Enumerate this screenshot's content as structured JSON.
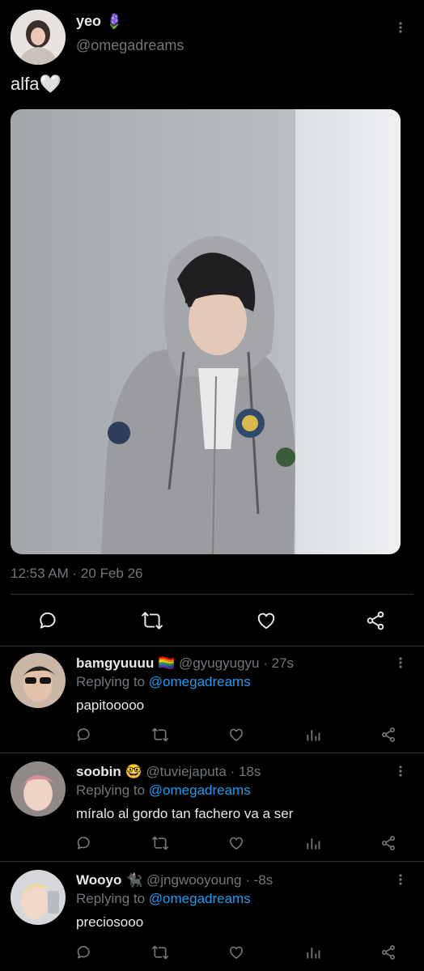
{
  "tweet": {
    "author_name": "yeo",
    "author_emoji": "🪻",
    "author_handle": "@omegadreams",
    "text": "alfa🤍",
    "timestamp": "12:53 AM · 20 Feb 26"
  },
  "replies": [
    {
      "name": "bamgyuuuu",
      "emoji": "🏳️‍🌈",
      "handle": "@gyugyugyu",
      "time": "· 27s",
      "replying_prefix": "Replying to",
      "replying_handle": "@omegadreams",
      "text": "papitooooo"
    },
    {
      "name": "soobin",
      "emoji": "🤓",
      "handle": "@tuviejaputa",
      "time": "· 18s",
      "replying_prefix": "Replying to",
      "replying_handle": "@omegadreams",
      "text": "míralo al gordo tan fachero va a ser"
    },
    {
      "name": "Wooyo",
      "emoji": "🐈‍⬛",
      "handle": "@jngwooyoung",
      "time": "· -8s",
      "replying_prefix": "Replying to",
      "replying_handle": "@omegadreams",
      "text": "preciosooo"
    }
  ],
  "icons": [
    "more-vertical-icon",
    "reply-icon",
    "retweet-icon",
    "like-icon",
    "share-icon",
    "analytics-icon"
  ],
  "colors": {
    "background": "#000000",
    "text": "#e7e9ea",
    "secondary": "#71767b",
    "link": "#1d9bf0",
    "divider": "#2f3336"
  }
}
